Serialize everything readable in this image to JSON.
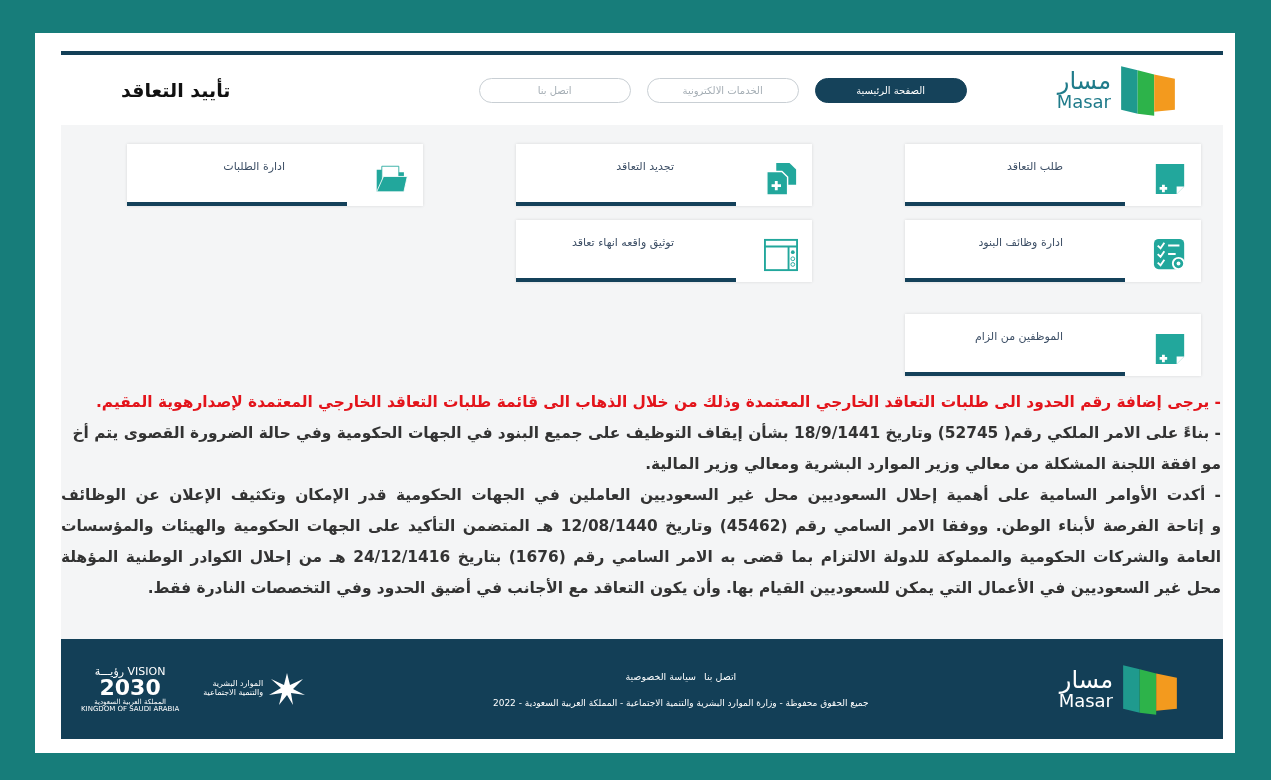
{
  "header": {
    "logo": {
      "arabic": "مسار",
      "latin": "Masar"
    },
    "tabs": [
      {
        "label": "الصفحة الرئيسية",
        "selected": true
      },
      {
        "label": "الخدمات الالكترونية",
        "selected": false
      },
      {
        "label": "اتصل بنا",
        "selected": false
      }
    ],
    "title": "تأييد التعاقد"
  },
  "cards": [
    [
      {
        "label": "طلب التعاقد",
        "kind": "doc-plus"
      },
      {
        "label": "تجديد التعاقد",
        "kind": "docs-plus"
      },
      {
        "label": "ادارة الطلبات",
        "kind": "folder"
      }
    ],
    [
      {
        "label": "ادارة وظائف البنود",
        "kind": "checklist"
      },
      {
        "label": "توثيق واقعه انهاء تعاقد",
        "kind": "window"
      }
    ],
    [
      {
        "label": "الموظفين من الزام",
        "kind": "doc-plus"
      }
    ]
  ],
  "notice_lines": [
    {
      "text": "- يرجى إضافة رقم الحدود الى طلبات التعاقد الخارجي المعتمدة وذلك من خلال الذهاب الى قائمة طلبات التعاقد الخارجي المعتمدة لإصدارهوية المقيم.",
      "kind": "alert"
    },
    {
      "text": "- بناءً على الامر الملكي رقم( 52745) وتاريخ 18/9/1441 بشأن إيقاف التوظيف على جميع البنود في الجهات الحكومية وفي حالة الضرورة القصوى يتم أخ",
      "kind": "normal"
    },
    {
      "text": "مو افقة اللجنة المشكلة من معالي وزير الموارد البشرية ومعالي وزير المالية.",
      "kind": "normal"
    },
    {
      "text": "- أكدت الأوامر السامية على أهمية إحلال السعوديين محل غير السعوديين العاملين في الجهات الحكومية قدر الإمكان وتكثيف الإعلان عن الوظائف",
      "kind": "justified"
    },
    {
      "text": "و إتاحة الفرصة لأبناء الوطن. ووفقا الامر السامي رقم (45462) وتاريخ 12/08/1440 هـ المتضمن التأكيد على الجهات الحكومية والهيئات والمؤسسات",
      "kind": "justified"
    },
    {
      "text": "العامة والشركات الحكومية والمملوكة للدولة الالتزام بما قضى به الامر السامي رقم (1676) بتاريخ 24/12/1416 هـ من إحلال الكوادر الوطنية المؤهلة",
      "kind": "justified"
    },
    {
      "text": "محل غير السعوديين في الأعمال التي يمكن للسعوديين القيام بها. وأن يكون التعاقد مع الأجانب في أضيق الحدود وفي التخصصات النادرة فقط.",
      "kind": "normal"
    }
  ],
  "footer": {
    "logo": {
      "arabic": "مسار",
      "latin": "Masar"
    },
    "links": [
      "اتصل بنا",
      "سياسة الخصوصية"
    ],
    "copyright": "جميع الحقوق محفوظة - وزارة الموارد البشرية والتنمية الاجتماعية - المملكة العربية السعودية - 2022",
    "ministry": [
      "الموارد البشرية",
      "والتنمية الاجتماعية"
    ],
    "vision": {
      "top": "VISION رؤيـــة",
      "year": "2030",
      "arabic": "المملكة العربية السعودية",
      "latin": "KINGDOM OF SAUDI ARABIA"
    }
  }
}
